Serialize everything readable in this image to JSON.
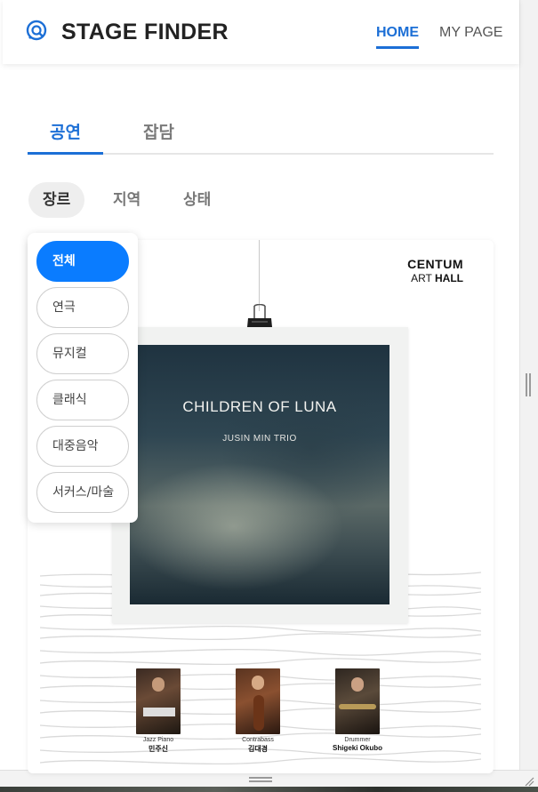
{
  "header": {
    "logo_icon": "search-ticket-icon",
    "title": "STAGE FINDER",
    "nav": {
      "home": "HOME",
      "my_page": "MY PAGE"
    },
    "accent": "#1c6fd6"
  },
  "main_tabs": [
    {
      "label": "공연",
      "active": true
    },
    {
      "label": "잡담",
      "active": false
    }
  ],
  "filters": [
    {
      "label": "장르",
      "active": true
    },
    {
      "label": "지역",
      "active": false
    },
    {
      "label": "상태",
      "active": false
    }
  ],
  "genre_dropdown": {
    "items": [
      {
        "label": "전체",
        "selected": true
      },
      {
        "label": "연극",
        "selected": false
      },
      {
        "label": "뮤지컬",
        "selected": false
      },
      {
        "label": "클래식",
        "selected": false
      },
      {
        "label": "대중음악",
        "selected": false
      },
      {
        "label": "서커스/마술",
        "selected": false
      }
    ],
    "selected_color": "#0a7cff"
  },
  "poster": {
    "venue_line1": "CENTUM",
    "venue_line2_prefix": "ART",
    "venue_line2_suffix": "HALL",
    "title": "CHILDREN OF LUNA",
    "subtitle": "JUSIN MIN TRIO",
    "members": [
      {
        "role": "Jazz Piano",
        "name": "민주신"
      },
      {
        "role": "Contrabass",
        "name": "김대경"
      },
      {
        "role": "Drummer",
        "name": "Shigeki Okubo"
      }
    ]
  }
}
